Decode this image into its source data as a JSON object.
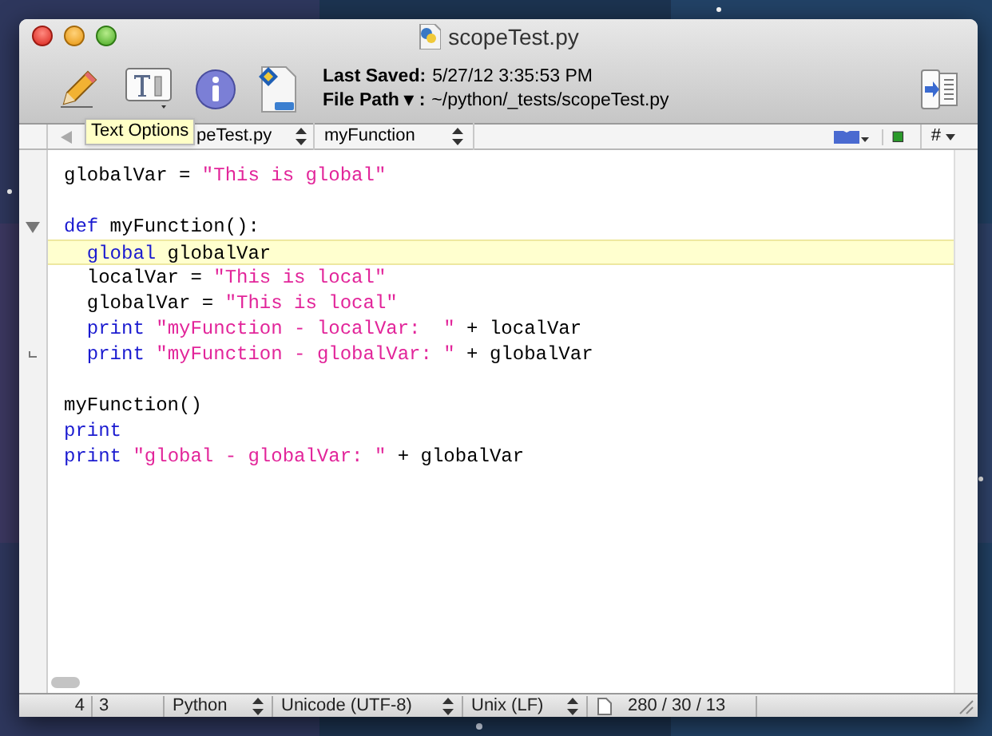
{
  "window": {
    "title": "scopeTest.py"
  },
  "toolbar": {
    "tooltip": "Text Options",
    "last_saved_label": "Last Saved:",
    "last_saved": "5/27/12 3:35:53 PM",
    "file_path_label": "File Path ▾ :",
    "file_path": "~/python/_tests/scopeTest.py"
  },
  "navbar": {
    "file": "peTest.py",
    "function": "myFunction",
    "counter_menu": "#"
  },
  "editor": {
    "lines": [
      {
        "current": false,
        "tokens": [
          {
            "kind": "plain",
            "text": "globalVar = "
          },
          {
            "kind": "string",
            "text": "\"This is global\""
          }
        ]
      },
      {
        "current": false
      },
      {
        "current": false,
        "fold_start": true,
        "tokens": [
          {
            "kind": "keyword",
            "text": "def"
          },
          {
            "kind": "plain",
            "text": " myFunction():"
          }
        ]
      },
      {
        "current": true,
        "tokens": [
          {
            "kind": "keyword",
            "text": "  global"
          },
          {
            "kind": "plain",
            "text": " globalVar"
          }
        ]
      },
      {
        "current": false,
        "tokens": [
          {
            "kind": "plain",
            "text": "  localVar = "
          },
          {
            "kind": "string",
            "text": "\"This is local\""
          }
        ]
      },
      {
        "current": false,
        "tokens": [
          {
            "kind": "plain",
            "text": "  globalVar = "
          },
          {
            "kind": "string",
            "text": "\"This is local\""
          }
        ]
      },
      {
        "current": false,
        "tokens": [
          {
            "kind": "keyword",
            "text": "  print"
          },
          {
            "kind": "string",
            "text": " \"myFunction - localVar:  \""
          },
          {
            "kind": "plain",
            "text": " + localVar"
          }
        ]
      },
      {
        "current": false,
        "fold_end": true,
        "tokens": [
          {
            "kind": "keyword",
            "text": "  print"
          },
          {
            "kind": "string",
            "text": " \"myFunction - globalVar: \""
          },
          {
            "kind": "plain",
            "text": " + globalVar"
          }
        ]
      },
      {
        "current": false
      },
      {
        "current": false,
        "tokens": [
          {
            "kind": "plain",
            "text": "myFunction()"
          }
        ]
      },
      {
        "current": false,
        "tokens": [
          {
            "kind": "keyword",
            "text": "print"
          }
        ]
      },
      {
        "current": false,
        "tokens": [
          {
            "kind": "keyword",
            "text": "print"
          },
          {
            "kind": "string",
            "text": " \"global - globalVar: \""
          },
          {
            "kind": "plain",
            "text": " + globalVar"
          }
        ]
      }
    ]
  },
  "status_bar": {
    "line": "4",
    "column": "3",
    "language": "Python",
    "encoding": "Unicode (UTF-8)",
    "line_endings": "Unix (LF)",
    "counts": "280 / 30 / 13"
  }
}
